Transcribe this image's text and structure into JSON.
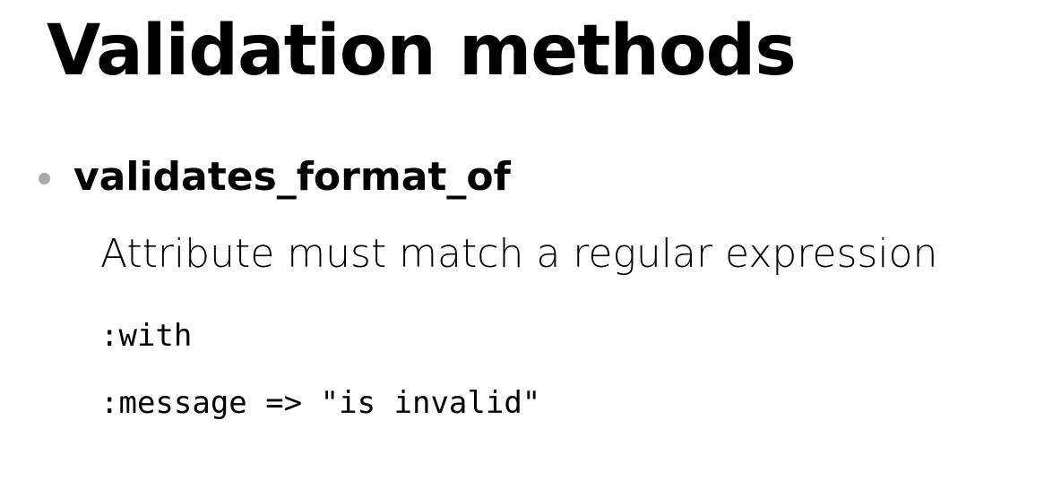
{
  "title": "Validation methods",
  "item": {
    "term": "validates_format_of",
    "description": "Attribute must match a regular expression",
    "options": [
      ":with",
      ":message => \"is invalid\""
    ]
  }
}
